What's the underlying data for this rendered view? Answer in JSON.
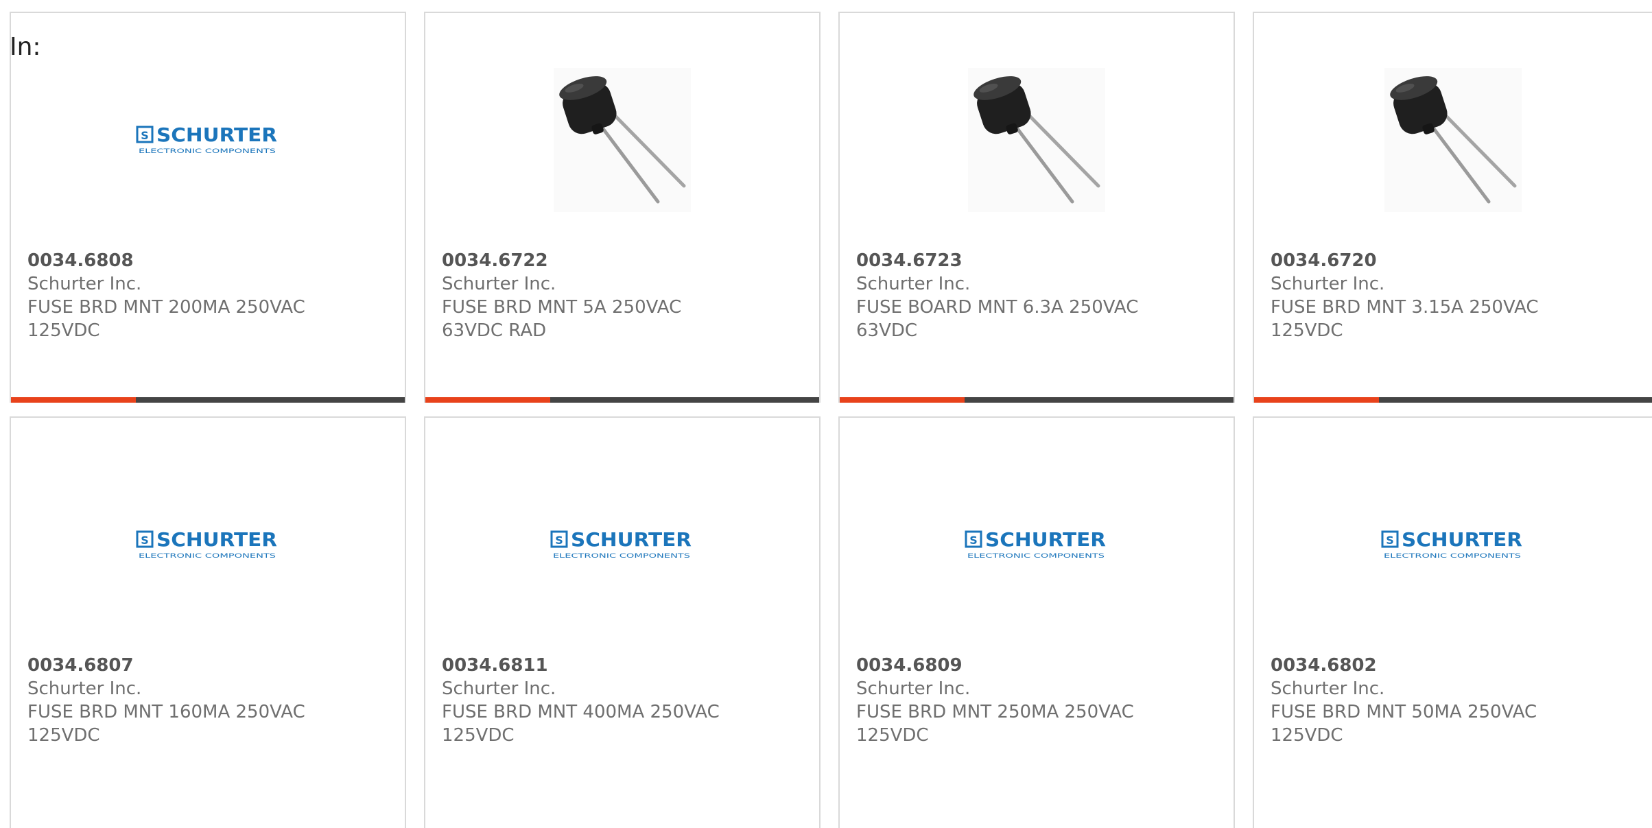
{
  "header": {
    "in_label": "In:"
  },
  "brand": {
    "logo_main": "SCHURTER",
    "logo_sub": "ELECTRONIC COMPONENTS",
    "logo_mark": "S",
    "logo_color": "#1b75bb"
  },
  "colors": {
    "accent": "#e8421b",
    "bar": "#444444",
    "border": "#d9d9d9"
  },
  "products": [
    {
      "part": "0034.6808",
      "mfr": "Schurter Inc.",
      "desc_line1": "FUSE BRD MNT 200MA 250VAC",
      "desc_line2": "125VDC",
      "image": "logo"
    },
    {
      "part": "0034.6722",
      "mfr": "Schurter Inc.",
      "desc_line1": "FUSE BRD MNT 5A 250VAC",
      "desc_line2": "63VDC RAD",
      "image": "fuse"
    },
    {
      "part": "0034.6723",
      "mfr": "Schurter Inc.",
      "desc_line1": "FUSE BOARD MNT 6.3A 250VAC",
      "desc_line2": "63VDC",
      "image": "fuse"
    },
    {
      "part": "0034.6720",
      "mfr": "Schurter Inc.",
      "desc_line1": "FUSE BRD MNT 3.15A 250VAC",
      "desc_line2": "125VDC",
      "image": "fuse"
    },
    {
      "part": "0034.6807",
      "mfr": "Schurter Inc.",
      "desc_line1": "FUSE BRD MNT 160MA 250VAC",
      "desc_line2": "125VDC",
      "image": "logo"
    },
    {
      "part": "0034.6811",
      "mfr": "Schurter Inc.",
      "desc_line1": "FUSE BRD MNT 400MA 250VAC",
      "desc_line2": "125VDC",
      "image": "logo"
    },
    {
      "part": "0034.6809",
      "mfr": "Schurter Inc.",
      "desc_line1": "FUSE BRD MNT 250MA 250VAC",
      "desc_line2": "125VDC",
      "image": "logo"
    },
    {
      "part": "0034.6802",
      "mfr": "Schurter Inc.",
      "desc_line1": "FUSE BRD MNT 50MA 250VAC",
      "desc_line2": "125VDC",
      "image": "logo"
    }
  ]
}
